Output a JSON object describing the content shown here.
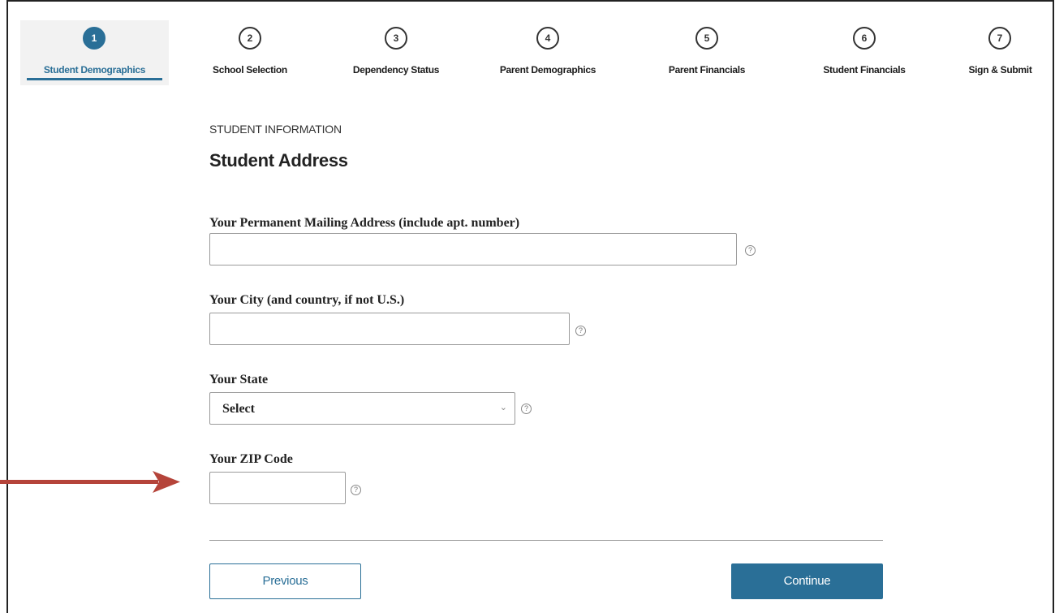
{
  "steps": [
    {
      "number": "1",
      "label": "Student Demographics",
      "active": true
    },
    {
      "number": "2",
      "label": "School Selection"
    },
    {
      "number": "3",
      "label": "Dependency Status"
    },
    {
      "number": "4",
      "label": "Parent Demographics"
    },
    {
      "number": "5",
      "label": "Parent Financials"
    },
    {
      "number": "6",
      "label": "Student Financials"
    },
    {
      "number": "7",
      "label": "Sign & Submit"
    }
  ],
  "section": {
    "kicker": "STUDENT INFORMATION",
    "title": "Student Address"
  },
  "fields": {
    "address": {
      "label": "Your Permanent Mailing Address (include apt. number)",
      "value": ""
    },
    "city": {
      "label": "Your City (and country, if not U.S.)",
      "value": ""
    },
    "state": {
      "label": "Your State",
      "selected": "Select"
    },
    "zip": {
      "label": "Your ZIP Code",
      "value": ""
    }
  },
  "help_glyph": "?",
  "buttons": {
    "previous": "Previous",
    "continue": "Continue"
  },
  "colors": {
    "accent": "#2a6f97",
    "arrow": "#b5443a"
  },
  "icons": [
    "help-icon",
    "chevron-down-icon",
    "red-arrow-icon"
  ]
}
